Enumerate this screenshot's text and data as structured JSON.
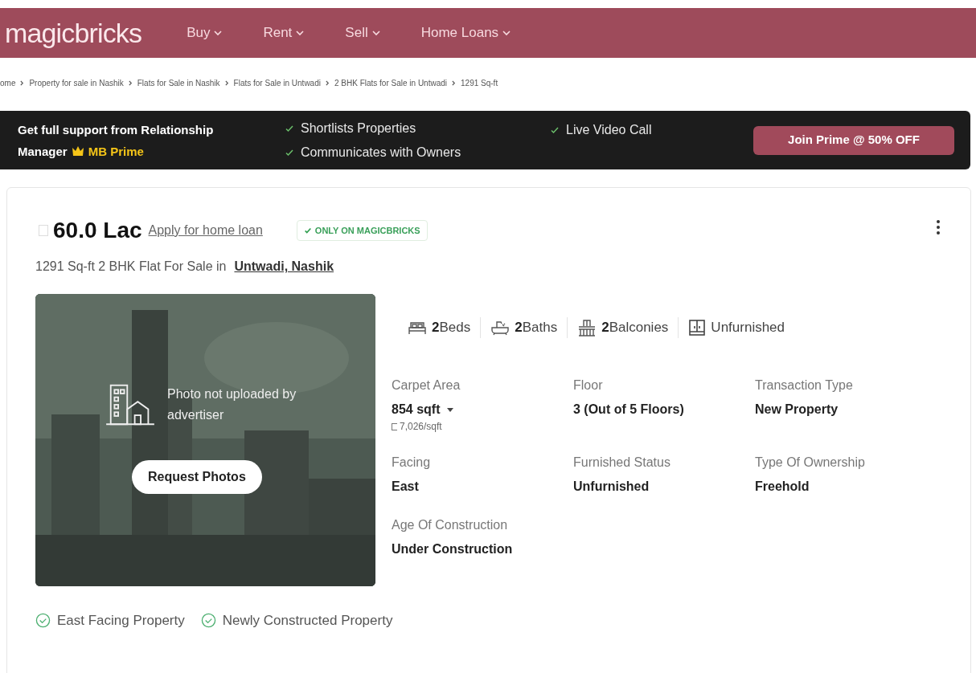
{
  "header": {
    "logo": "magicbricks",
    "nav": [
      {
        "label": "Buy"
      },
      {
        "label": "Rent"
      },
      {
        "label": "Sell"
      },
      {
        "label": "Home Loans"
      }
    ]
  },
  "breadcrumb": [
    "ome",
    "Property for sale in Nashik",
    "Flats for Sale in Nashik",
    "Flats for Sale in Untwadi",
    "2 BHK Flats for Sale in Untwadi",
    "1291 Sq-ft"
  ],
  "prime_banner": {
    "text_lines": [
      "Get full support from Relationship",
      "Manager"
    ],
    "badge": "MB Prime",
    "features": [
      "Shortlists Properties",
      "Communicates with Owners",
      "Live Video Call"
    ],
    "button": "Join Prime @ 50% OFF"
  },
  "listing": {
    "price": "60.0 Lac",
    "loan_link": "Apply for home loan",
    "tag": "ONLY ON MAGICBRICKS",
    "title": "1291 Sq-ft 2 BHK Flat For Sale in",
    "location": "Untwadi, Nashik",
    "photo": {
      "kind": "picture",
      "message": "Photo not uploaded by advertiser",
      "button": "Request Photos"
    },
    "amenities": [
      {
        "kind": "beds",
        "count": "2",
        "label": "Beds"
      },
      {
        "kind": "baths",
        "count": "2",
        "label": "Baths"
      },
      {
        "kind": "balconies",
        "count": "2",
        "label": "Balconies"
      },
      {
        "kind": "furnishing",
        "label": "Unfurnished"
      }
    ],
    "details": [
      {
        "label": "Carpet Area",
        "value": "854 sqft",
        "sub": "7,026/sqft"
      },
      {
        "label": "Floor",
        "value": "3 (Out of 5 Floors)"
      },
      {
        "label": "Transaction Type",
        "value": "New Property"
      },
      {
        "label": "Facing",
        "value": "East"
      },
      {
        "label": "Furnished Status",
        "value": "Unfurnished"
      },
      {
        "label": "Type Of Ownership",
        "value": "Freehold"
      },
      {
        "label": "Age Of Construction",
        "value": "Under Construction"
      }
    ],
    "highlights": [
      "East Facing Property",
      "Newly Constructed Property"
    ]
  }
}
